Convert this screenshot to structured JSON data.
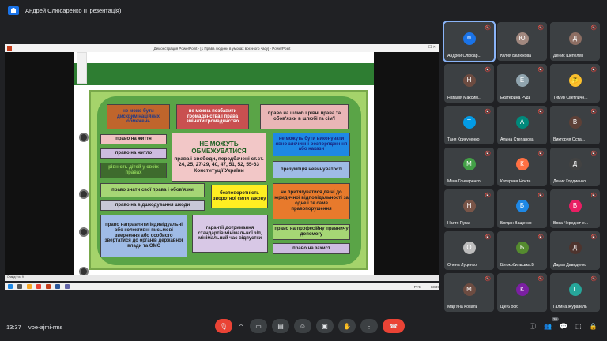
{
  "window_title": "Андрей Слюсаренко (Презентація)",
  "ppt": {
    "title": "Демонстрация PowerPoint - [1 Права людини в умовах воєнного часу] - PowerPoint",
    "controls": "—  ☐  ✕",
    "status": "Слайд 9 из 9"
  },
  "slide": {
    "center_title": "НЕ МОЖУТЬ ОБМЕЖУВАТИСЯ",
    "center_body": "права і свободи, передбачені ст.ст. 24, 25, 27-29, 40, 47, 51, 52, 55-63 Конституції України",
    "boxes": [
      "не може бути дискримінаційних обмежень",
      "не можна позбавити громадянства і права змінити громадянство",
      "право на шлюб і рівні права та обов'язки в шлюбі та сім'ї",
      "право на життя",
      "право на житло",
      "рівність дітей у своїх правах",
      "не можуть бути виконувати явно злочинні розпорядження або накази",
      "презумпція невинуватості",
      "право знати свої права і обов'язки",
      "право на відшкодування шкоди",
      "безповоротність зворотної сили закону",
      "не притягуватися двічі до юридичної відповідальності за одне і те саме правопорушення",
      "право направляти індивідуальні або колективні письмові звернення або особисто звертатися до органів державної влади та ОМС",
      "гарантії дотримання стандартів мінімальної з/п, мінімальний час відпустки",
      "право на професійну правничу допомогу",
      "право на захист"
    ]
  },
  "taskbar": {
    "clock": "13:37",
    "lang": "РУС"
  },
  "participants": [
    {
      "name": "Андрей Слюсар...",
      "initial": "✡",
      "color": "#1a73e8",
      "active": true
    },
    {
      "name": "Юлия Белюкова",
      "initial": "Ю",
      "color": "#a1887f"
    },
    {
      "name": "Денис Шепелев",
      "initial": "Д",
      "color": "#8d6e63"
    },
    {
      "name": "Наталія Максим...",
      "initial": "Н",
      "color": "#6d4c41"
    },
    {
      "name": "Екатерина Рудь",
      "initial": "Е",
      "color": "#90a4ae"
    },
    {
      "name": "Тимур Светличн...",
      "initial": "🤔",
      "color": "#fbc02d"
    },
    {
      "name": "Таня Крикуненко",
      "initial": "Т",
      "color": "#039be5"
    },
    {
      "name": "Алина Степанова",
      "initial": "А",
      "color": "#00897b"
    },
    {
      "name": "Виктория Оста...",
      "initial": "В",
      "color": "#5d4037"
    },
    {
      "name": "Міша Гончаренко",
      "initial": "М",
      "color": "#43a047"
    },
    {
      "name": "Катерина Ночте...",
      "initial": "К",
      "color": "#ff7043"
    },
    {
      "name": "Денис Гордиенко",
      "initial": "Д",
      "color": "#424242"
    },
    {
      "name": "Настя Пугач",
      "initial": "Н",
      "color": "#795548"
    },
    {
      "name": "Богдан Ващенко",
      "initial": "Б",
      "color": "#1e88e5"
    },
    {
      "name": "Вова Чередниче...",
      "initial": "В",
      "color": "#e91e63"
    },
    {
      "name": "Олена Луценко",
      "initial": "О",
      "color": "#bdbdbd"
    },
    {
      "name": "Білокобильська.В",
      "initial": "Б",
      "color": "#558b2f"
    },
    {
      "name": "Дарья Давиденко",
      "initial": "Д",
      "color": "#4e342e"
    },
    {
      "name": "Мар'яна Коваль",
      "initial": "М",
      "color": "#6d4c41"
    },
    {
      "name": "Ще 6 осіб",
      "initial": "К",
      "color": "#7b1fa2"
    },
    {
      "name": "Галина Журавель",
      "initial": "Г",
      "color": "#26a69a"
    }
  ],
  "meeting": {
    "time": "13:37",
    "code": "voe-ajmi-rms",
    "count_badge": "26"
  }
}
